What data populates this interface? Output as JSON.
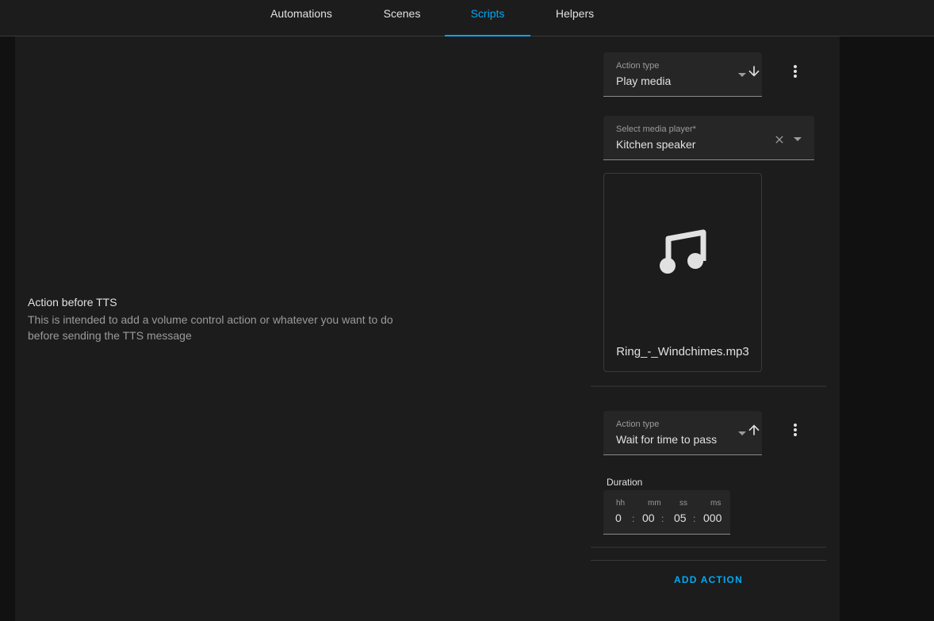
{
  "nav": {
    "tabs": [
      {
        "label": "Automations"
      },
      {
        "label": "Scenes"
      },
      {
        "label": "Scripts",
        "active": true
      },
      {
        "label": "Helpers"
      }
    ],
    "accent": "#03a9f4"
  },
  "section": {
    "title": "Action before TTS",
    "description": "This is intended to add a volume control action or whatever you want to do before sending the TTS message"
  },
  "action1": {
    "type_label": "Action type",
    "type_value": "Play media",
    "move_icon": "arrow-down-icon",
    "menu_icon": "more-vert-icon",
    "player_label": "Select media player*",
    "player_value": "Kitchen speaker",
    "media_icon": "music-note-icon",
    "media_name": "Ring_-_Windchimes.mp3"
  },
  "action2": {
    "type_label": "Action type",
    "type_value": "Wait for time to pass",
    "move_icon": "arrow-up-icon",
    "menu_icon": "more-vert-icon",
    "duration_label": "Duration",
    "units": {
      "hh": "hh",
      "mm": "mm",
      "ss": "ss",
      "ms": "ms"
    },
    "values": {
      "hh": "0",
      "mm": "00",
      "ss": "05",
      "ms": "000"
    },
    "colon": ":"
  },
  "add_action_label": "ADD ACTION"
}
